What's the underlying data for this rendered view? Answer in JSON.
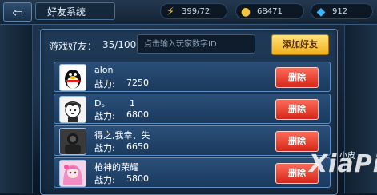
{
  "header": {
    "title": "好友系统",
    "back_icon": "back-arrow-icon",
    "stats": [
      {
        "icon": "lightning-icon",
        "value": "399/72",
        "color": "#f5c542"
      },
      {
        "icon": "gold-coin-icon",
        "value": "68471",
        "color": "#f2c43d"
      },
      {
        "icon": "diamond-icon",
        "value": "912",
        "color": "#39b6ff"
      }
    ]
  },
  "friends_panel": {
    "count_label": "游戏好友：",
    "count_value": "35/100",
    "search_placeholder": "点击输入玩家数字ID",
    "add_button": "添加好友",
    "power_label": "战力:",
    "delete_label": "删除",
    "friends": [
      {
        "name": "alon",
        "power": "7250",
        "avatar": "qq-penguin-avatar"
      },
      {
        "name": "D。       1",
        "power": "6800",
        "avatar": "cartoon-boy-avatar"
      },
      {
        "name": "得之,我幸、失",
        "power": "6650",
        "avatar": "dark-photo-avatar"
      },
      {
        "name": "枪神的荣耀",
        "power": "5800",
        "avatar": "anime-girl-avatar"
      }
    ]
  },
  "watermark": {
    "text": "XiaPi",
    "small_text": "小皮"
  }
}
